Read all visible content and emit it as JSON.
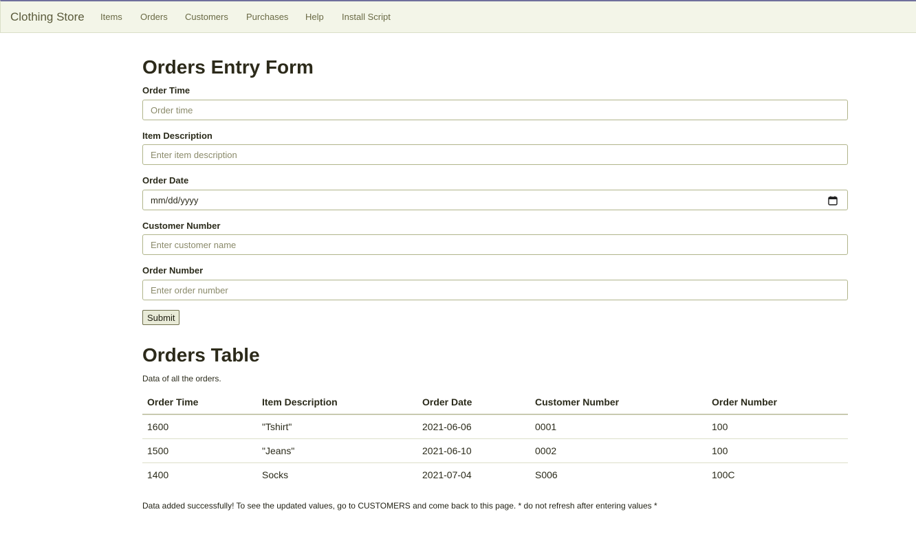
{
  "nav": {
    "brand": "Clothing Store",
    "links": [
      "Items",
      "Orders",
      "Customers",
      "Purchases",
      "Help",
      "Install Script"
    ]
  },
  "form": {
    "title": "Orders Entry Form",
    "fields": [
      {
        "label": "Order Time",
        "placeholder": "Order time",
        "value": ""
      },
      {
        "label": "Item Description",
        "placeholder": "Enter item description",
        "value": ""
      },
      {
        "label": "Order Date",
        "placeholder": "mm/dd/yyyy",
        "value": "",
        "icon": "calendar-icon"
      },
      {
        "label": "Customer Number",
        "placeholder": "Enter customer name",
        "value": ""
      },
      {
        "label": "Order Number",
        "placeholder": "Enter order number",
        "value": ""
      }
    ],
    "submit_label": "Submit"
  },
  "table": {
    "title": "Orders Table",
    "caption": "Data of all the orders.",
    "columns": [
      "Order Time",
      "Item Description",
      "Order Date",
      "Customer Number",
      "Order Number"
    ],
    "rows": [
      [
        "1600",
        "\"Tshirt\"",
        "2021-06-06",
        "0001",
        "100"
      ],
      [
        "1500",
        "\"Jeans\"",
        "2021-06-10",
        "0002",
        "100"
      ],
      [
        "1400",
        "Socks",
        "2021-07-04",
        "S006",
        "100C"
      ]
    ]
  },
  "status_message": "Data added successfully! To see the updated values, go to CUSTOMERS and come back to this page. * do not refresh after entering values *"
}
